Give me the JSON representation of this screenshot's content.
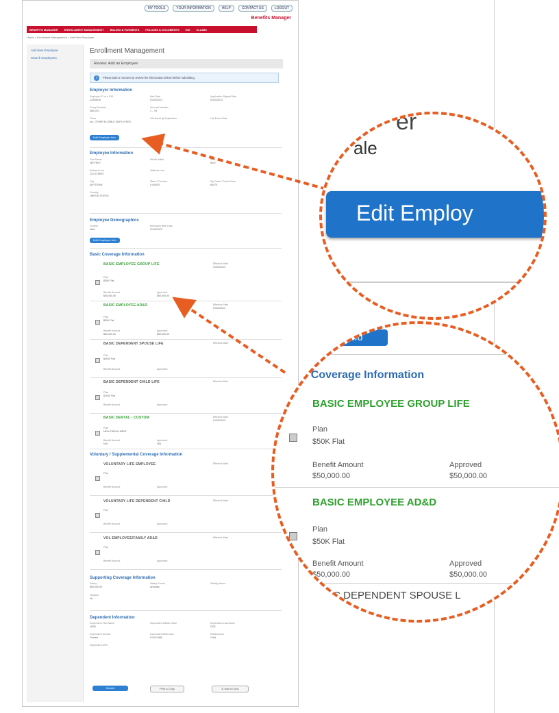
{
  "toolbar": {
    "mytools": "MY TOOLS",
    "yourinfo": "YOUR INFORMATION",
    "help": "HELP",
    "contact": "CONTACT US",
    "logout": "LOGOUT"
  },
  "brand": "Benefits Manager",
  "nav": [
    "BENEFITS MANAGER",
    "ENROLLMENT MANAGEMENT",
    "BILLING & PAYMENTS",
    "POLICIES & DOCUMENTS",
    "EDI",
    "CLAIMS"
  ],
  "breadcrumb": "Home > Enrollment Management > Add New Employee",
  "sidebar": [
    "Add New Employee",
    "Search Employees"
  ],
  "page": {
    "title": "Enrollment Management",
    "subtitle": "Review: Add an Employee",
    "info": "Please take a moment to review the information below before submitting."
  },
  "employer": {
    "title": "Employer Information",
    "employer_no_label": "Employer ID or # GID",
    "employer_no": "12345678",
    "hire_label": "Hire Date",
    "hire": "01/02/2013",
    "app_label": "Application Signed Date",
    "app": "01/02/2013",
    "group_label": "Group Number",
    "group": "0897221",
    "account_label": "Account Number",
    "account": "1 - 7/4",
    "class_label": "Class",
    "class": "ALL OTHER ELIGIBLE EMPLOYEES",
    "life_label": "Life Event @ Application",
    "lifedate_label": "Life Event Date",
    "edit": "Edit Employer Info"
  },
  "employee": {
    "title": "Employee Information",
    "first_label": "First Name",
    "first": "JEFFREY",
    "middle_label": "Middle Initial",
    "ssn_label": "SSN",
    "ssn": "5537",
    "addr1_label": "Address Line",
    "addr1": "131 STREET",
    "addr2_label": "Address Line",
    "city_label": "City",
    "city": "ANYTOWN",
    "state_label": "State / Province",
    "state": "ILLINOIS",
    "zip_label": "Zip Code / Postal Code",
    "zip": "60075",
    "country_label": "Country",
    "country": "UNITED STATES"
  },
  "demographics": {
    "title": "Employee Demographics",
    "gender_label": "Gender",
    "gender": "Male",
    "birth_label": "Employee Birth Date",
    "birth": "01/18/1970",
    "edit": "Edit Employee Info"
  },
  "basic": {
    "title": "Basic Coverage Information",
    "items": [
      {
        "name": "BASIC EMPLOYEE GROUP LIFE",
        "color": "#2ea02e",
        "plan": "$50K Flat",
        "amount": "$50,000.00",
        "approved": "$50,000.00",
        "eff": "01/02/2013"
      },
      {
        "name": "BASIC EMPLOYEE AD&D",
        "color": "#2ea02e",
        "plan": "$50K Flat",
        "amount": "$50,000.00",
        "approved": "$50,000.00",
        "eff": "01/02/2013"
      },
      {
        "name": "BASIC DEPENDENT SPOUSE LIFE",
        "color": "#555555",
        "plan": "$5000 Flat",
        "amount": "",
        "approved": "",
        "eff": ""
      },
      {
        "name": "BASIC DEPENDENT CHILD LIFE",
        "color": "#555555",
        "plan": "$2000 Flat",
        "amount": "",
        "approved": "",
        "eff": ""
      },
      {
        "name": "BASIC DENTAL - CUSTOM",
        "color": "#2ea02e",
        "plan": "NEW ENROLLMENT",
        "amount": "N/A",
        "approved": "N/A",
        "eff": "01/02/2013"
      }
    ]
  },
  "voluntary": {
    "title": "Voluntary / Supplemental Coverage Information",
    "items": [
      "VOLUNTARY LIFE EMPLOYEE",
      "VOLUNTARY LIFE DEPENDENT CHILD",
      "VOL EMPLOYEE/FAMILY AD&D"
    ]
  },
  "supporting": {
    "title": "Supporting Coverage Information",
    "salary_label": "Salary",
    "salary": "$50,000.00",
    "period_label": "Salary Period",
    "period": "Annually",
    "hours_label": "Weekly Hours",
    "tobacco_label": "Tobacco",
    "tobacco": "No"
  },
  "dependent": {
    "title": "Dependent Information",
    "first_label": "Dependent First Name",
    "first": "JANE",
    "middle_label": "Dependent Middle Initial",
    "last_label": "Dependent Last Name",
    "last": "DOE",
    "gender_label": "Dependent Gender",
    "gender": "Female",
    "birth_label": "Dependent Birth Date",
    "birth": "01/01/1980",
    "rel_label": "Relationship",
    "rel": "Child",
    "ssn_label": "Dependent SSN"
  },
  "footer": {
    "submit": "Submit",
    "print": "Print a Copy",
    "email": "E-mail a Copy"
  },
  "zoom1": {
    "partial_heading": "er",
    "partial_value": "ale",
    "button": "Edit Employ"
  },
  "zoom2": {
    "partial_button": "Info",
    "section": "ic Coverage Information",
    "item1": "BASIC EMPLOYEE GROUP LIFE",
    "plan_label": "Plan",
    "plan1": "$50K Flat",
    "amount_label": "Benefit Amount",
    "amount1": "$50,000.00",
    "approved_label": "Approved",
    "approved1": "$50,000.00",
    "item2": "BASIC EMPLOYEE AD&D",
    "plan2": "$50K Flat",
    "amount2": "$50,000.00",
    "approved2": "$50,000.00",
    "item3": "SIC DEPENDENT SPOUSE L"
  },
  "colors": {
    "accent_red": "#c8102e",
    "link_blue": "#2d6cb1",
    "button_blue": "#2c7fd1",
    "coverage_green": "#2ea02e",
    "callout_orange": "#e85d22"
  }
}
